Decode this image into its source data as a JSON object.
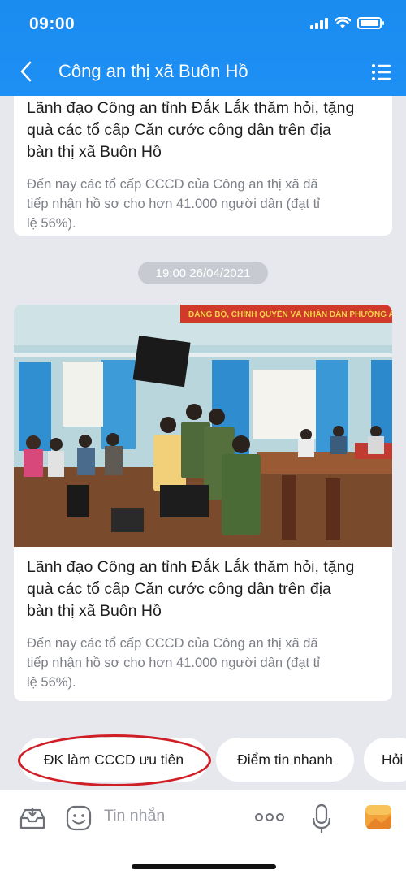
{
  "status": {
    "time": "09:00"
  },
  "header": {
    "title": "Công an thị xã Buôn Hồ"
  },
  "articles": [
    {
      "title_lines": [
        "Lãnh đạo Công an tỉnh Đắk Lắk thăm hỏi, tặng",
        "quà các tổ cấp Căn cước công dân trên địa",
        "bàn thị xã Buôn Hồ"
      ],
      "desc_lines": [
        "Đến nay các tổ cấp CCCD của Công an thị xã đã",
        "tiếp nhận hồ sơ cho hơn 41.000 người dân (đạt tỉ",
        "lệ 56%)."
      ]
    },
    {
      "banner_text": "ĐẢNG BỘ, CHÍNH QUYỀN VÀ NHÂN DÂN PHƯỜNG AN BÌNH QUY",
      "title_lines": [
        "Lãnh đạo Công an tỉnh Đắk Lắk thăm hỏi, tặng",
        "quà các tổ cấp Căn cước công dân trên địa",
        "bàn thị xã Buôn Hồ"
      ],
      "desc_lines": [
        "Đến nay các tổ cấp CCCD của Công an thị xã đã",
        "tiếp nhận hồ sơ cho hơn 41.000 người dân (đạt tỉ",
        "lệ 56%)."
      ]
    }
  ],
  "timestamp": "19:00 26/04/2021",
  "quick_replies": [
    "ĐK làm CCCD ưu tiên",
    "Điểm tin nhanh",
    "Hỏi"
  ],
  "input": {
    "placeholder": "Tin nhắn"
  },
  "colors": {
    "header": "#1e90f5",
    "highlight": "#d01e26",
    "sticker": "#f2a33a"
  }
}
